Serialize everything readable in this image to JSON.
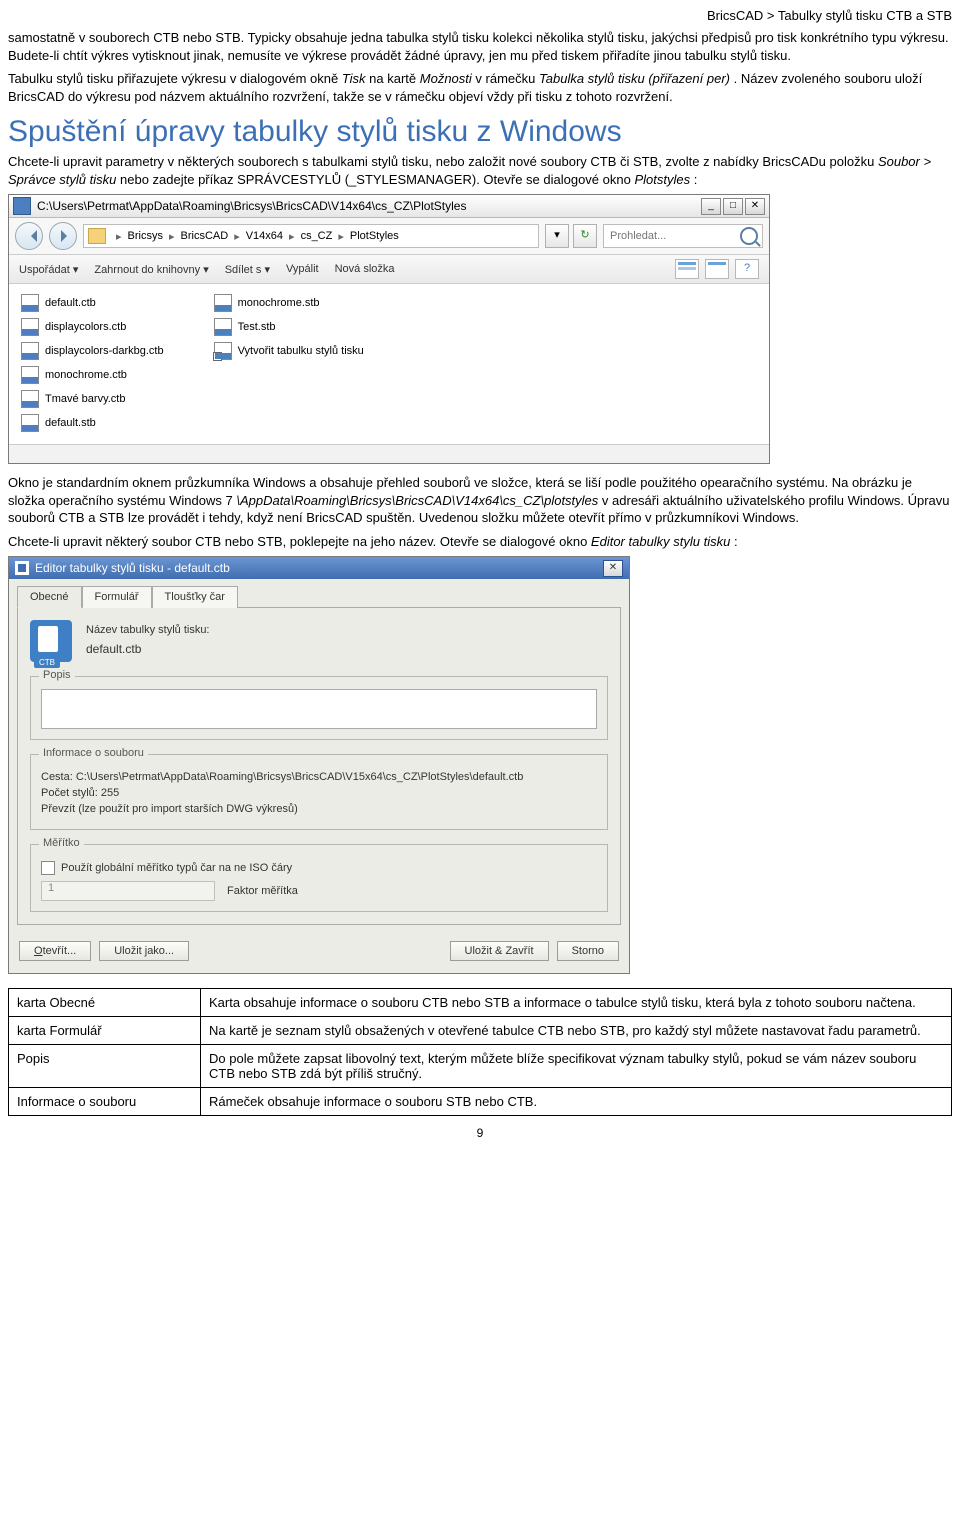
{
  "breadcrumb": "BricsCAD > Tabulky stylů tisku CTB a STB",
  "para1a": "samostatně v souborech CTB nebo STB. Typicky obsahuje jedna tabulka stylů tisku kolekci několika stylů tisku, jakýchsi předpisů pro tisk konkrétního typu výkresu. Budete-li chtít výkres vytisknout jinak, nemusíte ve výkrese provádět žádné úpravy, jen mu před tiskem přiřadíte jinou tabulku stylů tisku.",
  "para2_pre": "Tabulku stylů tisku přiřazujete výkresu v dialogovém okně ",
  "para2_i1": "Tisk",
  "para2_mid1": " na kartě ",
  "para2_i2": "Možnosti",
  "para2_mid2": " v rámečku ",
  "para2_i3": "Tabulka stylů tisku (přiřazení per)",
  "para2_post": ". Název zvoleného souboru uloží BricsCAD do výkresu pod názvem aktuálního rozvržení, takže se v rámečku objeví vždy při tisku z tohoto rozvržení.",
  "heading": "Spuštění úpravy tabulky stylů tisku z Windows",
  "para3_pre": "Chcete-li upravit parametry v některých souborech s tabulkami stylů tisku, nebo založit nové soubory CTB či STB, zvolte z nabídky BricsCADu položku ",
  "para3_i1": "Soubor > Správce stylů tisku",
  "para3_mid": " nebo zadejte příkaz SPRÁVCESTYLŮ (_STYLESMANAGER). Otevře se dialogové okno ",
  "para3_i2": "Plotstyles",
  "para3_post": ":",
  "explorer": {
    "title": "C:\\Users\\Petrmat\\AppData\\Roaming\\Bricsys\\BricsCAD\\V14x64\\cs_CZ\\PlotStyles",
    "crumbs": [
      "Bricsys",
      "BricsCAD",
      "V14x64",
      "cs_CZ",
      "PlotStyles"
    ],
    "search_placeholder": "Prohledat...",
    "toolbar": {
      "org": "Uspořádat",
      "lib": "Zahrnout do knihovny",
      "share": "Sdílet s",
      "burn": "Vypálit",
      "newf": "Nová složka"
    },
    "col1": [
      "default.ctb",
      "displaycolors.ctb",
      "displaycolors-darkbg.ctb",
      "monochrome.ctb",
      "Tmavé barvy.ctb",
      "default.stb"
    ],
    "col2": [
      "monochrome.stb",
      "Test.stb",
      "Vytvořit tabulku stylů tisku"
    ]
  },
  "para4_pre": "Okno je standardním oknem průzkumníka Windows a obsahuje přehled souborů ve složce, která se liší podle použitého opearačního systému. Na obrázku je složka operačního systému Windows 7 ",
  "para4_i1": "\\AppData\\Roaming\\Bricsys\\BricsCAD\\V14x64\\cs_CZ\\plotstyles",
  "para4_post": " v adresáři aktuálního uživatelského profilu Windows. Úpravu souborů CTB a STB lze provádět i tehdy, když není BricsCAD spuštěn. Uvedenou složku můžete otevřít přímo v průzkumníkovi Windows.",
  "para5_pre": "Chcete-li upravit některý soubor CTB nebo STB, poklepejte na jeho název. Otevře se dialogové okno ",
  "para5_i1": "Editor tabulky stylu tisku",
  "para5_post": ":",
  "editor": {
    "title": "Editor tabulky stylů tisku - default.ctb",
    "tabs": [
      "Obecné",
      "Formulář",
      "Tloušťky čar"
    ],
    "name_label": "Název tabulky stylů tisku:",
    "name_value": "default.ctb",
    "g1": "Popis",
    "g2": "Informace o souboru",
    "path": "Cesta: C:\\Users\\Petrmat\\AppData\\Roaming\\Bricsys\\BricsCAD\\V15x64\\cs_CZ\\PlotStyles\\default.ctb",
    "count": "Počet stylů: 255",
    "import": "Převzít (lze použít pro import starších DWG výkresů)",
    "g3": "Měřítko",
    "iso": "Použít globální měřítko typů čar na ne ISO čáry",
    "factor_label": "Faktor měřítka",
    "factor_val": "1",
    "btn_open": "Otevřít...",
    "btn_save": "Uložit jako...",
    "btn_sc": "Uložit & Zavřít",
    "btn_cancel": "Storno"
  },
  "table": {
    "r1l": "karta Obecné",
    "r1r": "Karta obsahuje informace o souboru CTB nebo STB a informace o tabulce stylů tisku, která byla z tohoto souboru načtena.",
    "r2l": "karta Formulář",
    "r2r": "Na kartě je seznam stylů obsažených v otevřené tabulce CTB nebo STB, pro každý styl můžete nastavovat řadu parametrů.",
    "r3l": "Popis",
    "r3r": "Do pole můžete zapsat libovolný text, kterým můžete blíže specifikovat význam tabulky stylů, pokud se vám název souboru CTB nebo STB zdá být příliš stručný.",
    "r4l": "Informace o souboru",
    "r4r": "Rámeček obsahuje informace o souboru STB nebo CTB."
  },
  "pagenum": "9"
}
